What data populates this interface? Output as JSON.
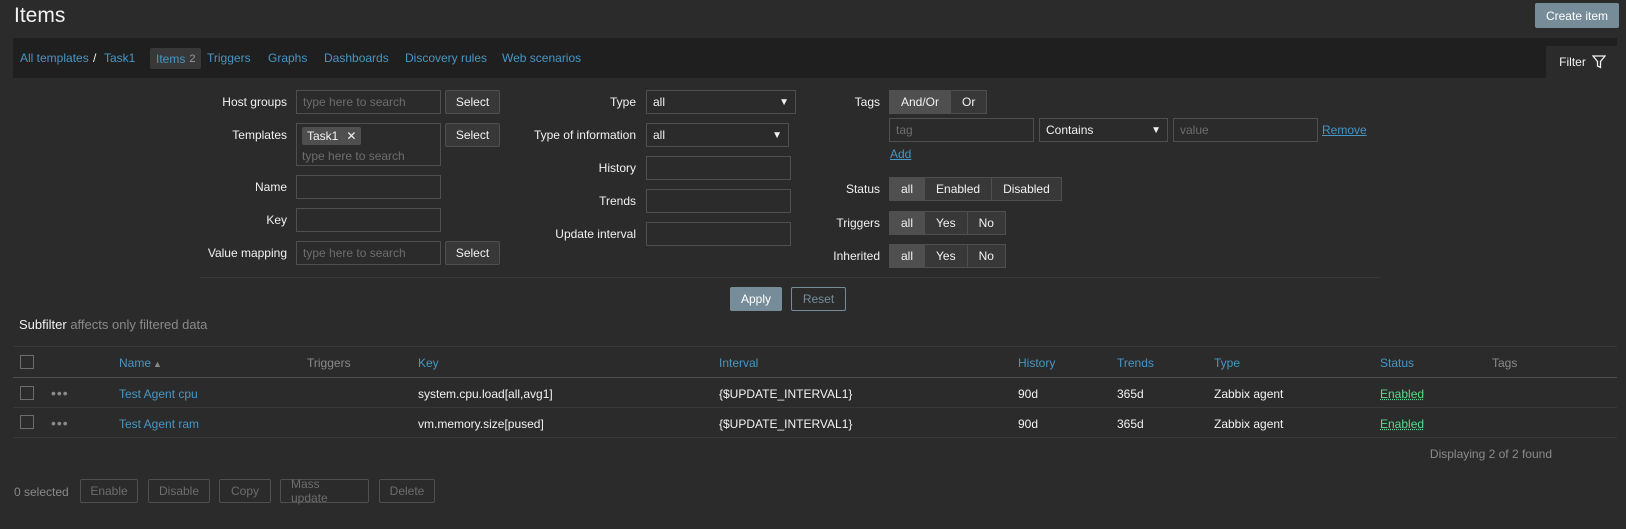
{
  "page": {
    "title": "Items",
    "create_button": "Create item"
  },
  "breadcrumb": {
    "all_templates": "All templates",
    "separator": "/",
    "template": "Task1"
  },
  "tabs": {
    "items": "Items",
    "items_count": "2",
    "triggers": "Triggers",
    "graphs": "Graphs",
    "dashboards": "Dashboards",
    "discovery": "Discovery rules",
    "web": "Web scenarios",
    "filter": "Filter"
  },
  "filter": {
    "host_groups": {
      "label": "Host groups",
      "placeholder": "type here to search",
      "button": "Select"
    },
    "templates": {
      "label": "Templates",
      "chip": "Task1",
      "placeholder": "type here to search",
      "button": "Select"
    },
    "name": {
      "label": "Name",
      "value": ""
    },
    "key": {
      "label": "Key",
      "value": ""
    },
    "value_mapping": {
      "label": "Value mapping",
      "placeholder": "type here to search",
      "button": "Select"
    },
    "type": {
      "label": "Type",
      "value": "all"
    },
    "type_of_information": {
      "label": "Type of information",
      "value": "all"
    },
    "history": {
      "label": "History",
      "value": ""
    },
    "trends": {
      "label": "Trends",
      "value": ""
    },
    "update_interval": {
      "label": "Update interval",
      "value": ""
    },
    "tags": {
      "label": "Tags",
      "andor": "And/Or",
      "or": "Or",
      "tag_placeholder": "tag",
      "operator": "Contains",
      "value_placeholder": "value",
      "remove": "Remove",
      "add": "Add"
    },
    "status": {
      "label": "Status",
      "options": [
        "all",
        "Enabled",
        "Disabled"
      ]
    },
    "triggers": {
      "label": "Triggers",
      "options": [
        "all",
        "Yes",
        "No"
      ]
    },
    "inherited": {
      "label": "Inherited",
      "options": [
        "all",
        "Yes",
        "No"
      ]
    },
    "apply": "Apply",
    "reset": "Reset"
  },
  "subfilter": {
    "title": "Subfilter",
    "note": "affects only filtered data"
  },
  "table": {
    "headers": {
      "name": "Name",
      "sort_arrow": "▲",
      "triggers": "Triggers",
      "key": "Key",
      "interval": "Interval",
      "history": "History",
      "trends": "Trends",
      "type": "Type",
      "status": "Status",
      "tags": "Tags"
    },
    "rows": [
      {
        "name": "Test Agent cpu",
        "key": "system.cpu.load[all,avg1]",
        "interval": "{$UPDATE_INTERVAL1}",
        "history": "90d",
        "trends": "365d",
        "type": "Zabbix agent",
        "status": "Enabled"
      },
      {
        "name": "Test Agent ram",
        "key": "vm.memory.size[pused]",
        "interval": "{$UPDATE_INTERVAL1}",
        "history": "90d",
        "trends": "365d",
        "type": "Zabbix agent",
        "status": "Enabled"
      }
    ],
    "footer": "Displaying 2 of 2 found"
  },
  "actions": {
    "selected": "0 selected",
    "enable": "Enable",
    "disable": "Disable",
    "copy": "Copy",
    "mass_update": "Mass update",
    "delete": "Delete"
  }
}
